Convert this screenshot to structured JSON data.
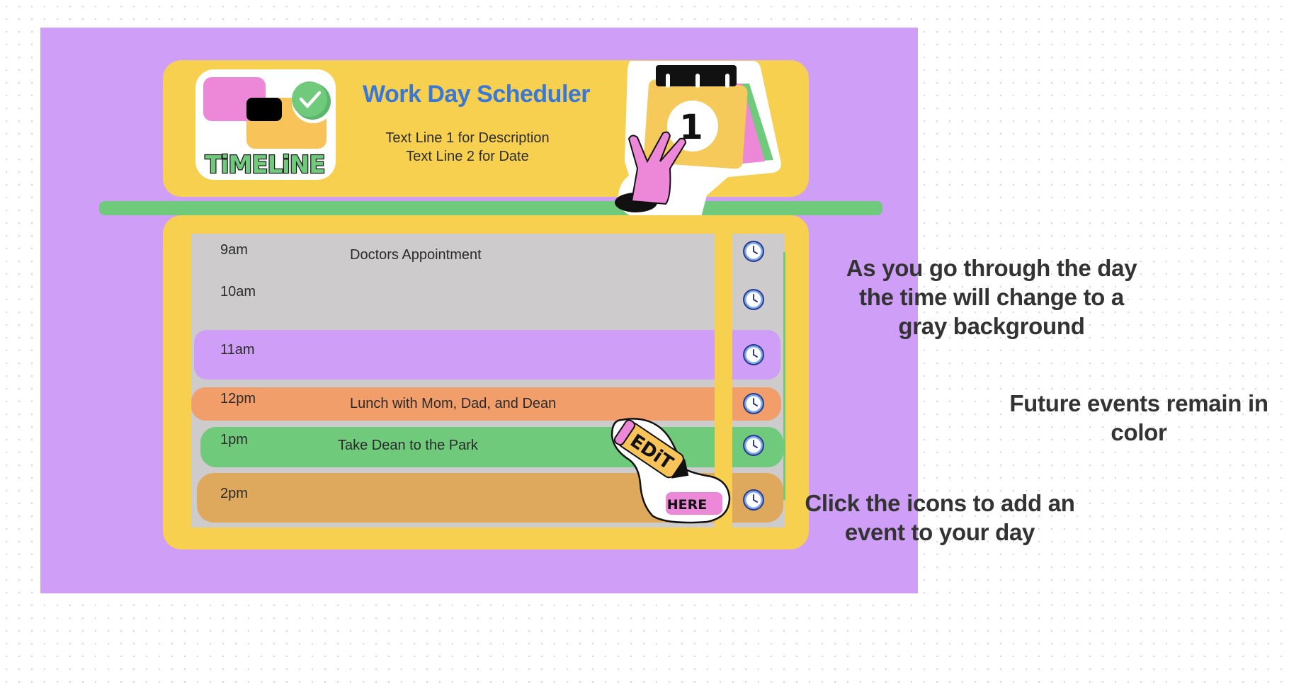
{
  "header": {
    "title": "Work Day Scheduler",
    "description_line1": "Text Line 1  for Description",
    "description_line2": "Text Line 2 for Date",
    "logo_text": "TiMELiNE",
    "calendar_number": "1"
  },
  "rows": [
    {
      "time": "9am",
      "event": "Doctors Appointment",
      "state": "past"
    },
    {
      "time": "10am",
      "event": "",
      "state": "past"
    },
    {
      "time": "11am",
      "event": "",
      "state": "future"
    },
    {
      "time": "12pm",
      "event": "Lunch with Mom, Dad, and Dean",
      "state": "future"
    },
    {
      "time": "1pm",
      "event": "Take Dean to the Park",
      "state": "future"
    },
    {
      "time": "2pm",
      "event": "",
      "state": "future"
    }
  ],
  "edit_sticker": {
    "edit_text": "EDiT",
    "here_text": "HERE"
  },
  "notes": {
    "past": "As you go through the day the time will change to a gray background",
    "future": "Future events remain in color",
    "click": "Click the icons to add an event to your day"
  },
  "colors": {
    "frame": "#cf9ef7",
    "card": "#f8d050",
    "past_gray": "#cdcbcb",
    "purple_row": "#cf9ef7",
    "orange_row": "#f29e6b",
    "green_row": "#6fca7b",
    "tan_row": "#dea95d",
    "title_blue": "#3a78d8"
  },
  "icons": {
    "save": "clock-icon"
  }
}
